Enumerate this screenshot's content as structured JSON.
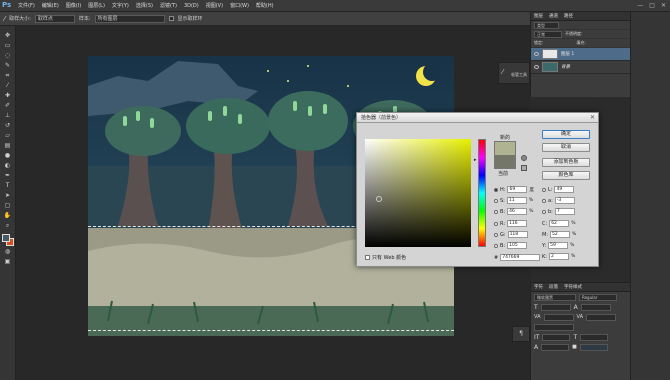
{
  "app": {
    "logo": "Ps"
  },
  "menubar": {
    "items": [
      "文件(F)",
      "编辑(E)",
      "图像(I)",
      "图层(L)",
      "文字(Y)",
      "选择(S)",
      "滤镜(T)",
      "3D(D)",
      "视图(V)",
      "窗口(W)",
      "帮助(H)"
    ]
  },
  "window_controls": {
    "minimize": "—",
    "maximize": "□",
    "close": "✕"
  },
  "options": {
    "brush_size_label": "取样大小:",
    "sample_size_value": "取样点",
    "sample_label": "样本:",
    "sample_value": "所有图层",
    "show_ring_label": "显示取样环"
  },
  "layers_panel": {
    "tabs": [
      "图层",
      "通道",
      "路径"
    ],
    "kind_label": "类型",
    "blend_mode": "正常",
    "opacity_label": "不透明度:",
    "lock_label": "锁定:",
    "fill_label": "填充:",
    "layers": [
      {
        "name": "图层 1",
        "active": true
      },
      {
        "name": "背景",
        "active": false
      }
    ]
  },
  "history_strip": {
    "label": "吸管工具"
  },
  "char_panel": {
    "tabs": [
      "字符",
      "段落",
      "字符样式"
    ],
    "font_value": "微软雅黑",
    "style_value": "Regular",
    "size_value": "",
    "leading_value": ""
  },
  "color_picker": {
    "title": "拾色器（前景色）",
    "new_label": "新的",
    "current_label": "当前",
    "ok": "确定",
    "cancel": "取消",
    "add_to_swatches": "添加到色板",
    "color_libraries": "颜色库",
    "H": "69",
    "H_unit": "度",
    "S": "11",
    "S_unit": "%",
    "B": "46",
    "B_unit": "%",
    "R": "116",
    "G": "118",
    "Bl": "105",
    "L": "49",
    "a": "-3",
    "b": "7",
    "C": "62",
    "M": "52",
    "Y": "59",
    "K": "2",
    "pct": "%",
    "only_web": "只有 Web 颜色",
    "hex_label": "#",
    "hex": "747669",
    "colors": {
      "current": "#747669",
      "new": "#b0b392"
    }
  }
}
